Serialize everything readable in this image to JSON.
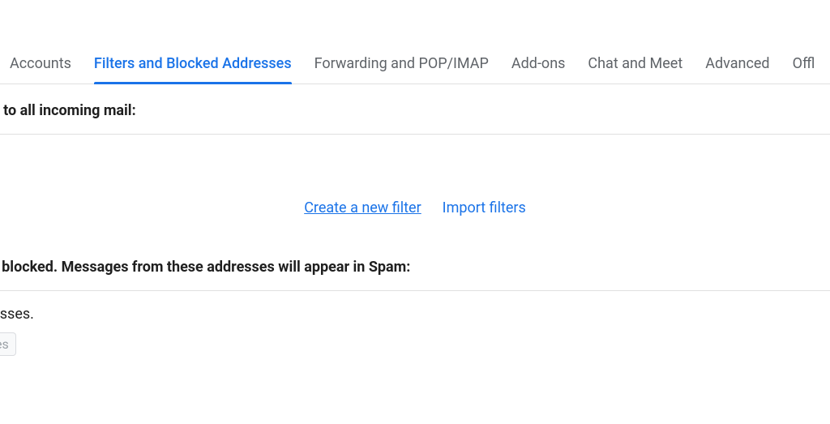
{
  "tabs": {
    "accounts": "Accounts",
    "filters": "Filters and Blocked Addresses",
    "forwarding": "Forwarding and POP/IMAP",
    "addons": "Add-ons",
    "chat": "Chat and Meet",
    "advanced": "Advanced",
    "offline": "Offl"
  },
  "sections": {
    "filters_heading": "pplied to all incoming mail:",
    "create_filter": "Create a new filter",
    "import_filters": "Import filters",
    "blocked_heading": "sses are blocked. Messages from these addresses will appear in Spam:",
    "blocked_text": "ed addresses.",
    "button_frag": "es"
  }
}
